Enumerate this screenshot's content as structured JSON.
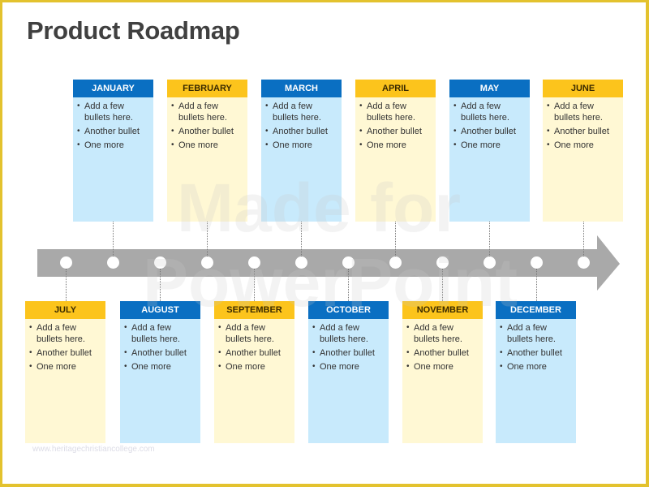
{
  "title": "Product Roadmap",
  "watermark": {
    "line1": "Made for",
    "line2": "PowerPoint"
  },
  "site_text": "www.heritagechristiancollege.com",
  "colors": {
    "blue_header": "#0a6fc2",
    "blue_body": "#c8eafc",
    "yellow_header": "#fcc41c",
    "yellow_body": "#fff8d4",
    "timeline": "#a9a9a9",
    "frame": "#e3c22e"
  },
  "months": [
    {
      "name": "JANUARY",
      "row": "top",
      "color": "blue",
      "bullets": [
        "Add a few bullets here.",
        "Another bullet",
        "One more"
      ]
    },
    {
      "name": "FEBRUARY",
      "row": "top",
      "color": "yellow",
      "bullets": [
        "Add a few bullets here.",
        "Another bullet",
        "One more"
      ]
    },
    {
      "name": "MARCH",
      "row": "top",
      "color": "blue",
      "bullets": [
        "Add a few bullets here.",
        "Another bullet",
        "One more"
      ]
    },
    {
      "name": "APRIL",
      "row": "top",
      "color": "yellow",
      "bullets": [
        "Add a few bullets here.",
        "Another bullet",
        "One more"
      ]
    },
    {
      "name": "MAY",
      "row": "top",
      "color": "blue",
      "bullets": [
        "Add a few bullets here.",
        "Another bullet",
        "One more"
      ]
    },
    {
      "name": "JUNE",
      "row": "top",
      "color": "yellow",
      "bullets": [
        "Add a few bullets here.",
        "Another bullet",
        "One more"
      ]
    },
    {
      "name": "JULY",
      "row": "bottom",
      "color": "yellow",
      "bullets": [
        "Add a few bullets here.",
        "Another bullet",
        "One more"
      ]
    },
    {
      "name": "AUGUST",
      "row": "bottom",
      "color": "blue",
      "bullets": [
        "Add a few bullets here.",
        "Another bullet",
        "One more"
      ]
    },
    {
      "name": "SEPTEMBER",
      "row": "bottom",
      "color": "yellow",
      "bullets": [
        "Add a few bullets here.",
        "Another bullet",
        "One more"
      ]
    },
    {
      "name": "OCTOBER",
      "row": "bottom",
      "color": "blue",
      "bullets": [
        "Add a few bullets here.",
        "Another bullet",
        "One more"
      ]
    },
    {
      "name": "NOVEMBER",
      "row": "bottom",
      "color": "yellow",
      "bullets": [
        "Add a few bullets here.",
        "Another bullet",
        "One more"
      ]
    },
    {
      "name": "DECEMBER",
      "row": "bottom",
      "color": "blue",
      "bullets": [
        "Add a few bullets here.",
        "Another bullet",
        "One more"
      ]
    }
  ]
}
